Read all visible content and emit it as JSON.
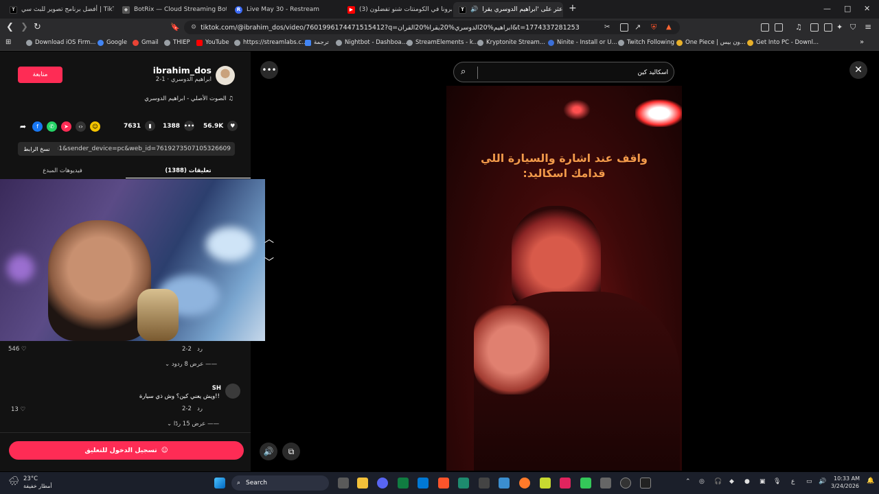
{
  "tabs": [
    {
      "label": "أفضل برنامج تصوير للبث سي | TikTok",
      "fav": "T",
      "color": "#000000"
    },
    {
      "label": "BotRix — Cloud Streaming Bot for Tw",
      "fav": "◆",
      "color": "#5a5a5a"
    },
    {
      "label": "Live May 30 - Restream",
      "fav": "R",
      "color": "#3d6bf5"
    },
    {
      "label": "(3) خبرونا في الكومنتات شنو تفضلون",
      "fav": "▶",
      "color": "#ff0000"
    },
    {
      "label": "اعثر على 'ابراهيم الدوسري يقرا",
      "fav": "T",
      "color": "#000000"
    }
  ],
  "new_tab": "+",
  "window_controls": {
    "minimize": "—",
    "maximize": "□",
    "close": "✕"
  },
  "address": {
    "url": "tiktok.com/@ibrahim_dos/video/7601996174471515412?q=ابراهيم%20الدوسري%20يقرا%20القران&t=1774337281253"
  },
  "bookmarks": [
    {
      "label": "Download iOS Firm...",
      "color": "#9aa0a6"
    },
    {
      "label": "Google",
      "color": "#4285f4"
    },
    {
      "label": "Gmail",
      "color": "#ea4335"
    },
    {
      "label": "THIEP",
      "color": "#9aa0a6"
    },
    {
      "label": "YouTube",
      "color": "#ff0000"
    },
    {
      "label": "https://streamlabs.c...",
      "color": "#9aa0a6"
    },
    {
      "label": "ترجمة",
      "color": "#4285f4"
    },
    {
      "label": "Nightbot - Dashboa...",
      "color": "#9aa0a6"
    },
    {
      "label": "StreamElements - k...",
      "color": "#9aa0a6"
    },
    {
      "label": "Kryptonite Stream...",
      "color": "#9aa0a6"
    },
    {
      "label": "Ninite - Install or U...",
      "color": "#3b6fd8"
    },
    {
      "label": "Twitch Following",
      "color": "#9aa0a6"
    },
    {
      "label": "One Piece | ون بيس...",
      "color": "#e8b02a"
    },
    {
      "label": "Get Into PC - Downl...",
      "color": "#e8b02a"
    }
  ],
  "profile": {
    "follow": "متابعة",
    "username": "ibrahim_dos",
    "subtitle": "ابراهيم الدوسري · 1-2",
    "sound": "الصوت الأصلي - ابراهيم الدوسري"
  },
  "stats": {
    "likes": "56.9K",
    "comments": "1388",
    "saves": "7631"
  },
  "copy": {
    "button": "نسخ الرابط",
    "url": "...p=1&sender_device=pc&web_id=7619273507105326609"
  },
  "panel_tabs": {
    "comments": "تعليقات (1388)",
    "creator_videos": "فيديوهات المبدع"
  },
  "comments": [
    {
      "likes": "546",
      "date": "2-2",
      "reply": "رد",
      "view_replies": "عرض 8 ردود"
    },
    {
      "username": "SH",
      "text": "ويش يعني كين؟ وش ذي سيارة!!",
      "likes": "13",
      "date": "2-2",
      "reply": "رد",
      "view_replies": "عرض 15 ردًا"
    }
  ],
  "login_button": "تسجيل الدخول للتعليق",
  "search": {
    "value": "اسكاليد كين"
  },
  "video": {
    "caption_line1": "واقف عند اشارة والسيارة اللي",
    "caption_line2": "قدامك اسكاليد:"
  },
  "taskbar": {
    "weather_temp": "23°C",
    "weather_desc": "أمطار خفيفة",
    "search": "Search",
    "lang": "ع",
    "time": "10:33 AM",
    "date": "3/24/2026"
  },
  "colors": {
    "accent": "#fe2c55",
    "caption": "#f29a4a"
  }
}
